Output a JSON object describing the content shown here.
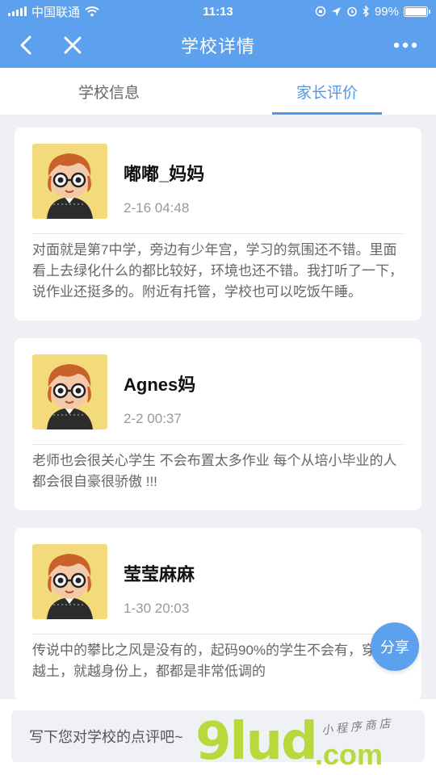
{
  "status": {
    "carrier": "中国联通",
    "time": "11:13",
    "battery": "99%"
  },
  "nav": {
    "title": "学校详情"
  },
  "tabs": [
    {
      "label": "学校信息",
      "active": false
    },
    {
      "label": "家长评价",
      "active": true
    }
  ],
  "reviews": [
    {
      "name": "嘟嘟_妈妈",
      "date": "2-16 04:48",
      "text": "对面就是第7中学，旁边有少年宫，学习的氛围还不错。里面看上去绿化什么的都比较好，环境也还不错。我打听了一下，说作业还挺多的。附近有托管，学校也可以吃饭午睡。"
    },
    {
      "name": "Agnes妈",
      "date": "2-2 00:37",
      "text": "老师也会很关心学生 不会布置太多作业 每个从培小毕业的人都会很自豪很骄傲 !!!"
    },
    {
      "name": "莹莹麻麻",
      "date": "1-30 20:03",
      "text": "传说中的攀比之风是没有的，起码90%的学生不会有，穿戴得越土，就越身份上，都都是非常低调的"
    }
  ],
  "share_label": "分享",
  "input": {
    "placeholder": "写下您对学校的点评吧~"
  },
  "watermark": {
    "logo": "9lud",
    "domain": ".com",
    "tagline": "小 程 序 商 店"
  },
  "colors": {
    "accent": "#5da0ee",
    "tab_active": "#4a9ae8"
  }
}
